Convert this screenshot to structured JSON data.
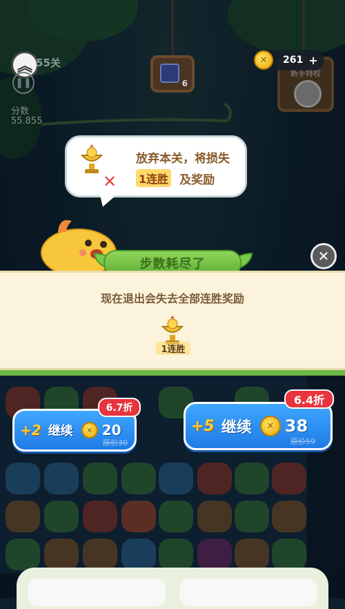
{
  "hud": {
    "level_label": "55关",
    "score_label": "分数",
    "score_value": "55.855",
    "coins": "261",
    "coins_plus": "+",
    "hanging_sign_count": "6",
    "right_sign_label": "新手特权"
  },
  "bubble": {
    "line1": "放弃本关，将损失",
    "streak_badge": "1连胜",
    "line2_suffix": "及奖励"
  },
  "dialog": {
    "title": "步数耗尽了",
    "close_icon": "close-icon",
    "message": "现在退出会失去全部连胜奖励",
    "reward_label": "1连胜"
  },
  "options": [
    {
      "plus_moves": "+2",
      "label": "继续",
      "price": "20",
      "original_price": "原价30",
      "discount": "6.7折"
    },
    {
      "plus_moves": "+5",
      "label": "继续",
      "price": "38",
      "original_price": "原价59",
      "discount": "6.4折"
    }
  ],
  "colors": {
    "band_bg": "#fbf3dc",
    "ribbon_green": "#6db844",
    "button_blue": "#2b8ff0",
    "discount_red": "#e8343e",
    "coin_gold": "#f2c21b"
  }
}
